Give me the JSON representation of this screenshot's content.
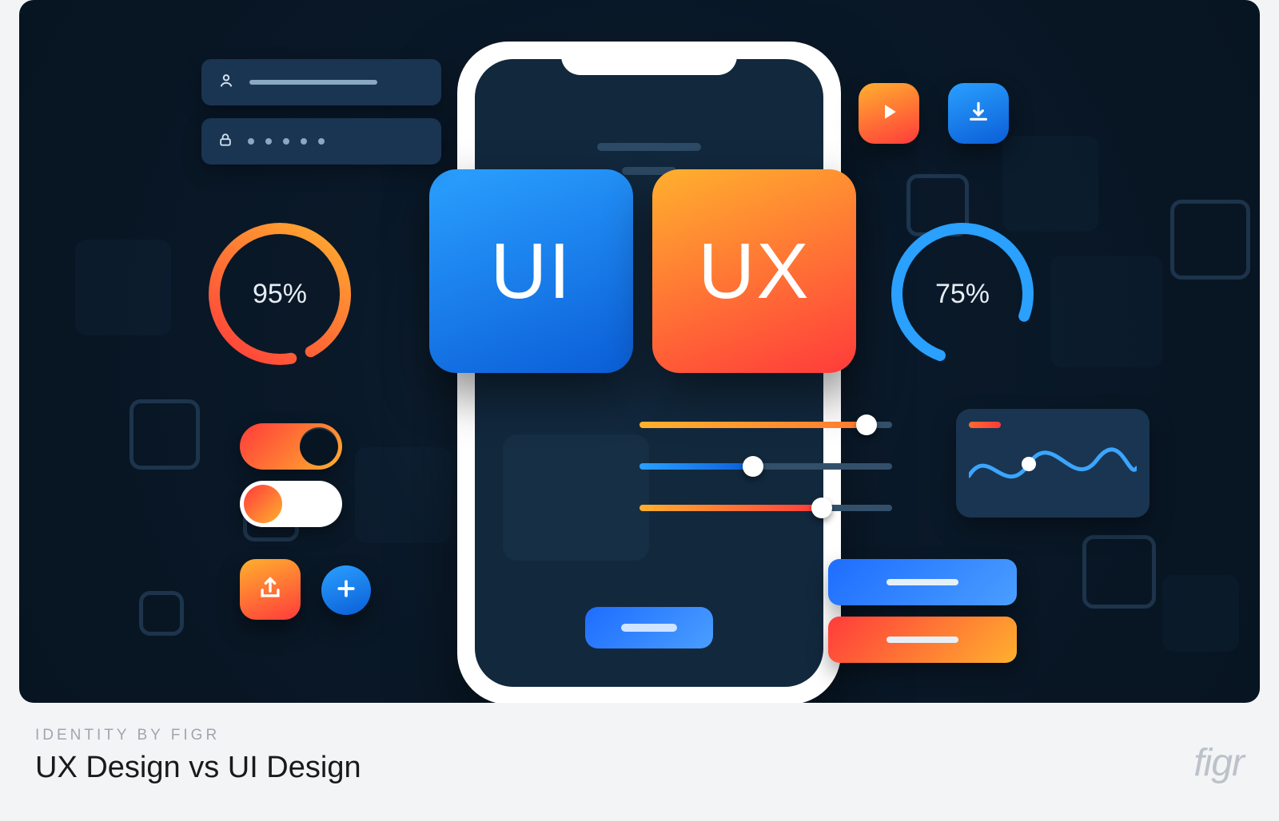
{
  "hero": {
    "card_ui_label": "UI",
    "card_ux_label": "UX",
    "progress_left": {
      "percent": 95,
      "label": "95%",
      "color": "#ff5a3c"
    },
    "progress_right": {
      "percent": 75,
      "label": "75%",
      "color": "#2aa0ff"
    },
    "sliders": [
      {
        "percent": 90,
        "color": "#ffb02e"
      },
      {
        "percent": 45,
        "color": "#2aa0ff"
      },
      {
        "percent": 72,
        "color": "#ff7a2e"
      }
    ],
    "toggles": {
      "top_on": true,
      "bottom_on": false
    },
    "icons": {
      "play": "play-icon",
      "download": "download-icon",
      "share": "share-icon",
      "add": "plus-icon",
      "user": "user-icon",
      "lock": "lock-icon"
    }
  },
  "footer": {
    "kicker": "IDENTITY BY FIGR",
    "title": "UX Design vs UI Design",
    "brand": "figr"
  },
  "colors": {
    "blue_grad": [
      "#2aa0ff",
      "#0b5ed7"
    ],
    "orange_grad": [
      "#ffb02e",
      "#ff3b3b"
    ],
    "panel": "#1a3552",
    "bg_dark": "#0a1929"
  }
}
